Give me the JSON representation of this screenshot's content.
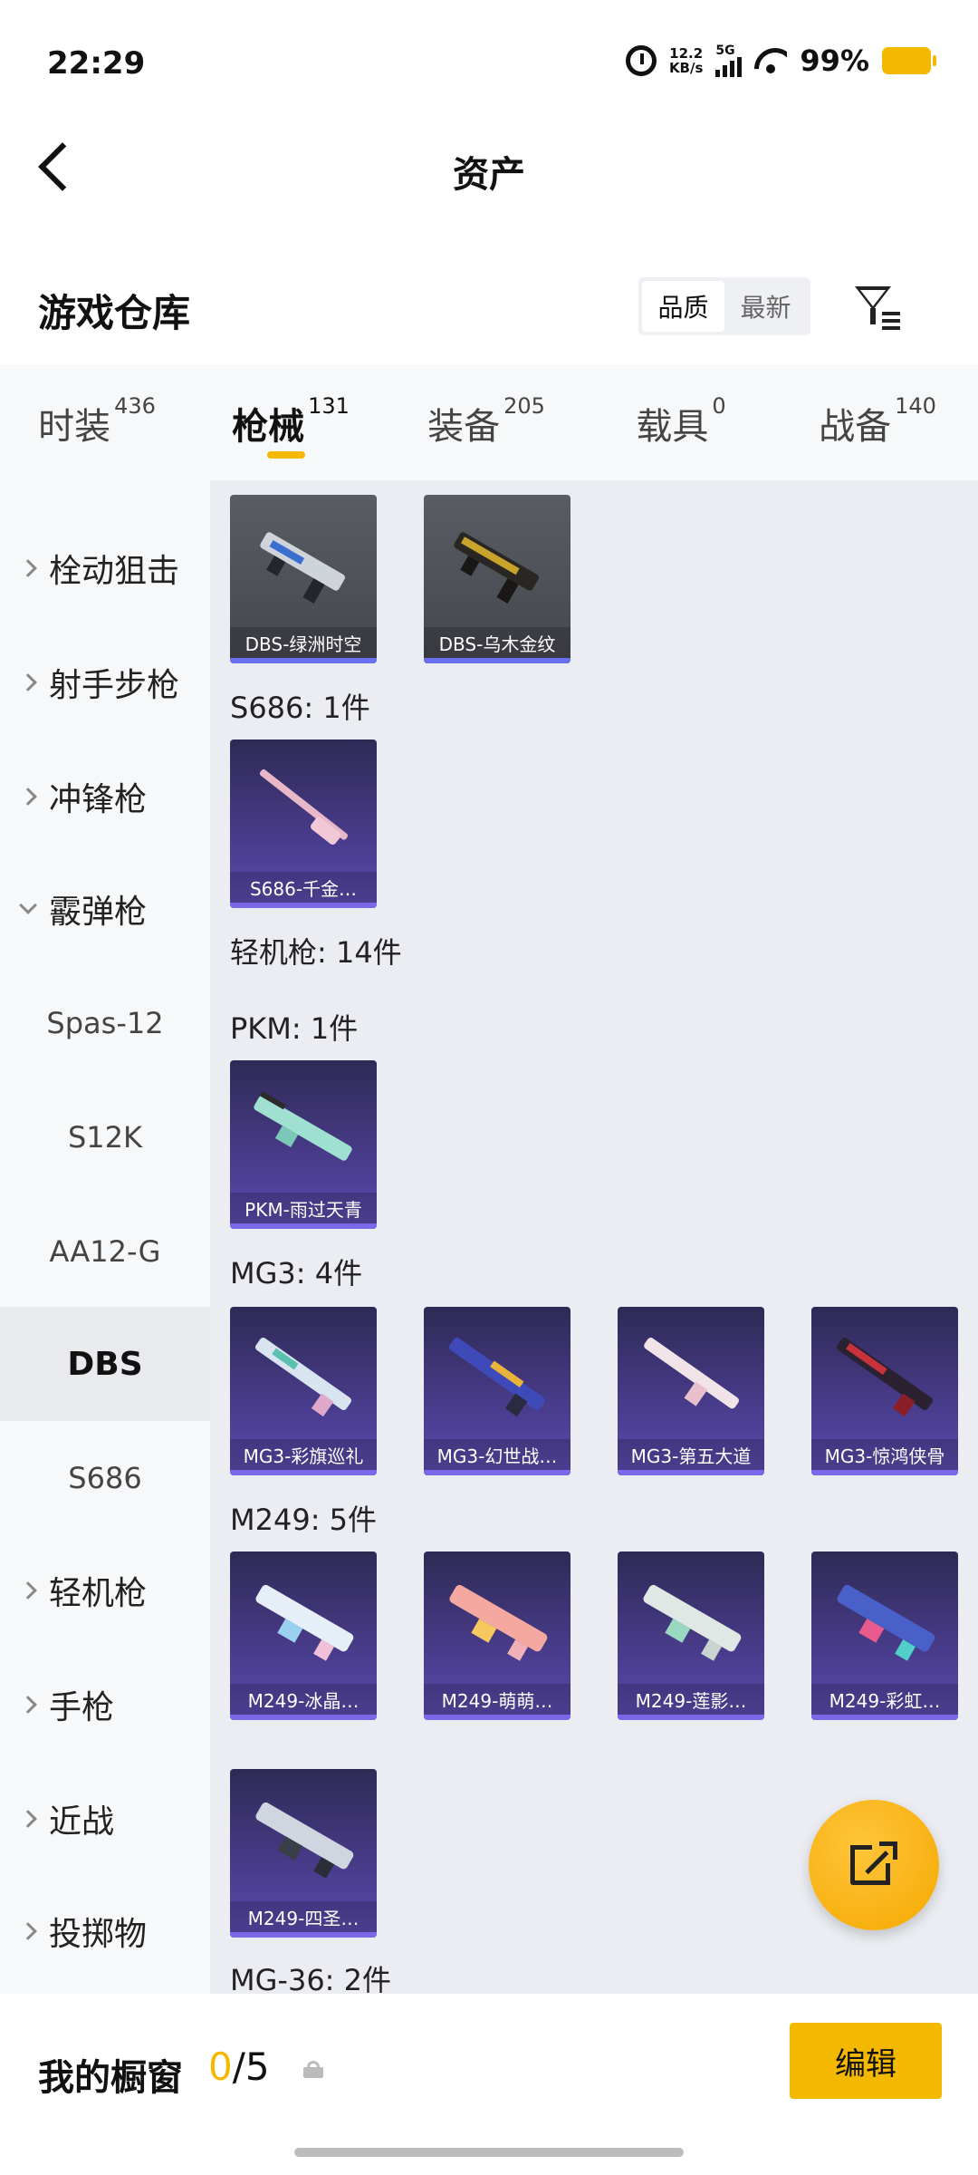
{
  "status": {
    "time": "22:29",
    "net_speed_value": "12.2",
    "net_speed_unit": "KB/s",
    "network": "5G",
    "battery": "99%"
  },
  "header": {
    "title": "资产"
  },
  "section": {
    "title": "游戏仓库",
    "sort_options": [
      "品质",
      "最新"
    ],
    "active_sort": "品质"
  },
  "tabs": [
    {
      "label": "时装",
      "count": "436"
    },
    {
      "label": "枪械",
      "count": "131"
    },
    {
      "label": "装备",
      "count": "205"
    },
    {
      "label": "载具",
      "count": "0"
    },
    {
      "label": "战备",
      "count": "140"
    }
  ],
  "active_tab": "枪械",
  "sidebar": {
    "items": [
      {
        "label": "栓动狙击"
      },
      {
        "label": "射手步枪"
      },
      {
        "label": "冲锋枪"
      },
      {
        "label": "霰弹枪"
      },
      {
        "label": "Spas-12"
      },
      {
        "label": "S12K"
      },
      {
        "label": "AA12-G"
      },
      {
        "label": "DBS"
      },
      {
        "label": "S686"
      },
      {
        "label": "轻机枪"
      },
      {
        "label": "手枪"
      },
      {
        "label": "近战"
      },
      {
        "label": "投掷物"
      }
    ],
    "selected": "DBS"
  },
  "content": {
    "dbs_cards": [
      "DBS-绿洲时空",
      "DBS-乌木金纹"
    ],
    "s686_label": "S686: 1件",
    "s686_cards": [
      "S686-千金…"
    ],
    "lmg_label": "轻机枪: 14件",
    "pkm_label": "PKM: 1件",
    "pkm_cards": [
      "PKM-雨过天青"
    ],
    "mg3_label": "MG3: 4件",
    "mg3_cards": [
      "MG3-彩旗巡礼",
      "MG3-幻世战…",
      "MG3-第五大道",
      "MG3-惊鸿侠骨"
    ],
    "m249_label": "M249: 5件",
    "m249_cards": [
      "M249-冰晶…",
      "M249-萌萌…",
      "M249-莲影…",
      "M249-彩虹…",
      "M249-四圣…"
    ],
    "mg36_label": "MG-36: 2件"
  },
  "bottom": {
    "showcase_label": "我的橱窗",
    "showcase_used": "0",
    "showcase_total": "/5",
    "edit_label": "编辑"
  },
  "colors": {
    "accent": "#f5b800",
    "purple_card": "#4e3f95",
    "gray_card": "#4e5058"
  }
}
